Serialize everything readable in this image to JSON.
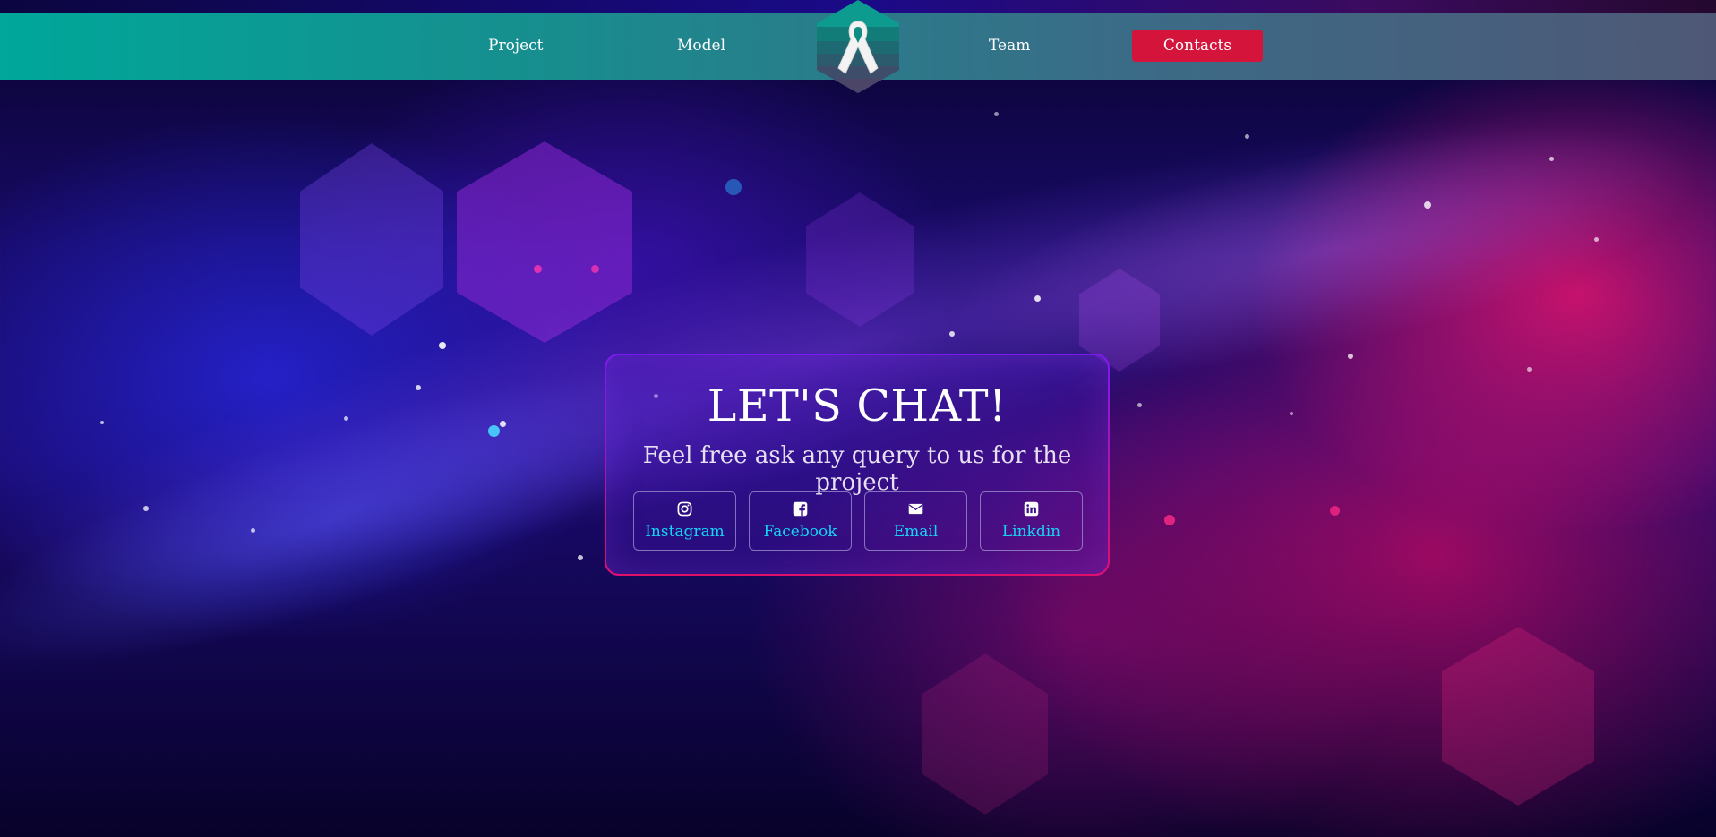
{
  "nav": {
    "links": [
      {
        "label": "Project"
      },
      {
        "label": "Model"
      },
      {
        "label": "Team"
      }
    ],
    "active_label": "Contacts",
    "logo_icon": "ribbon-icon",
    "colors": {
      "bar_start": "#00a79a",
      "bar_end": "#4e5876",
      "active": "#d4143a"
    }
  },
  "contact_card": {
    "title": "LET'S CHAT!",
    "subtitle": "Feel free ask any query to us for the project",
    "socials": [
      {
        "label": "Instagram",
        "icon": "instagram-icon"
      },
      {
        "label": "Facebook",
        "icon": "facebook-icon"
      },
      {
        "label": "Email",
        "icon": "envelope-icon"
      },
      {
        "label": "Linkdin",
        "icon": "linkedin-icon"
      }
    ],
    "colors": {
      "link": "#17d2f6",
      "border": "#b01ad8"
    }
  }
}
